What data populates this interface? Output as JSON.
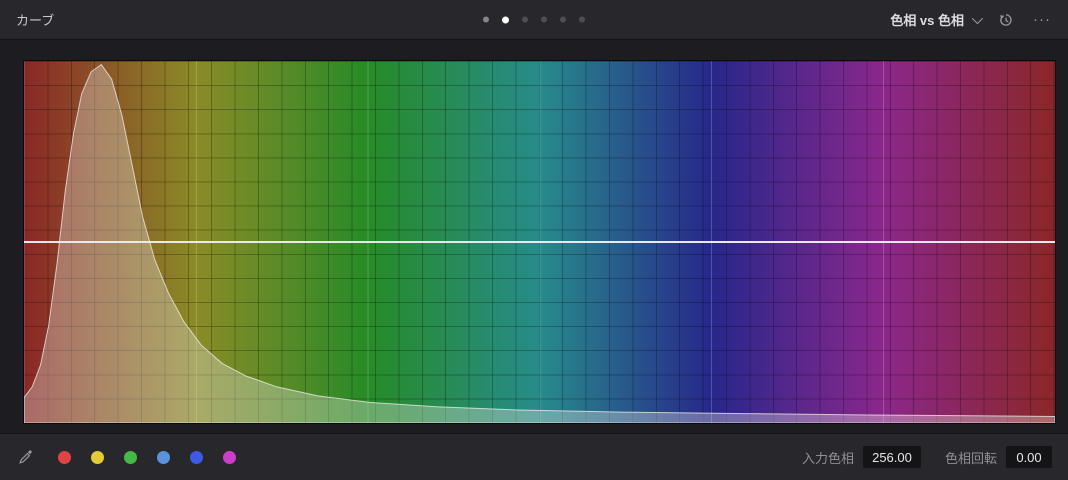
{
  "header": {
    "title": "カーブ",
    "pager": {
      "active": 1,
      "dot_colors": [
        "#85858a",
        "#ffffff",
        "#4e4e53",
        "#4e4e53",
        "#4e4e53",
        "#4e4e53"
      ]
    },
    "mode": {
      "label": "色相 vs 色相"
    },
    "more_label": "···"
  },
  "graph": {
    "spectrum": [
      "#8b2727",
      "#8b5927",
      "#8b8b27",
      "#598b27",
      "#278b27",
      "#278b59",
      "#278b8b",
      "#27598b",
      "#27278b",
      "#59278b",
      "#8b278b",
      "#8b2759",
      "#8b2727"
    ],
    "curve_y": 0.5,
    "curve_color": "#eaeaee",
    "histogram_fill": "rgba(228,224,220,0.36)",
    "histogram_stroke": "rgba(242,240,238,0.75)",
    "histogram": [
      [
        0.0,
        0.07
      ],
      [
        0.008,
        0.1
      ],
      [
        0.016,
        0.16
      ],
      [
        0.024,
        0.27
      ],
      [
        0.032,
        0.44
      ],
      [
        0.04,
        0.64
      ],
      [
        0.048,
        0.8
      ],
      [
        0.056,
        0.91
      ],
      [
        0.065,
        0.97
      ],
      [
        0.075,
        0.99
      ],
      [
        0.085,
        0.95
      ],
      [
        0.095,
        0.85
      ],
      [
        0.105,
        0.71
      ],
      [
        0.115,
        0.57
      ],
      [
        0.127,
        0.45
      ],
      [
        0.14,
        0.36
      ],
      [
        0.155,
        0.28
      ],
      [
        0.172,
        0.215
      ],
      [
        0.192,
        0.165
      ],
      [
        0.215,
        0.13
      ],
      [
        0.245,
        0.1
      ],
      [
        0.285,
        0.075
      ],
      [
        0.335,
        0.057
      ],
      [
        0.4,
        0.045
      ],
      [
        0.48,
        0.036
      ],
      [
        0.58,
        0.03
      ],
      [
        0.7,
        0.026
      ],
      [
        0.82,
        0.022
      ],
      [
        0.92,
        0.02
      ],
      [
        1.0,
        0.018
      ]
    ]
  },
  "footer": {
    "swatches": [
      {
        "name": "red",
        "color": "#df4343"
      },
      {
        "name": "yellow",
        "color": "#e4cc35"
      },
      {
        "name": "green",
        "color": "#45b945"
      },
      {
        "name": "sky-blue",
        "color": "#5b92dc"
      },
      {
        "name": "blue",
        "color": "#3c5be0"
      },
      {
        "name": "magenta",
        "color": "#cb3ecb"
      }
    ],
    "fields": [
      {
        "name": "input-hue",
        "label": "入力色相",
        "value": "256.00"
      },
      {
        "name": "hue-rotation",
        "label": "色相回転",
        "value": "0.00"
      }
    ]
  }
}
